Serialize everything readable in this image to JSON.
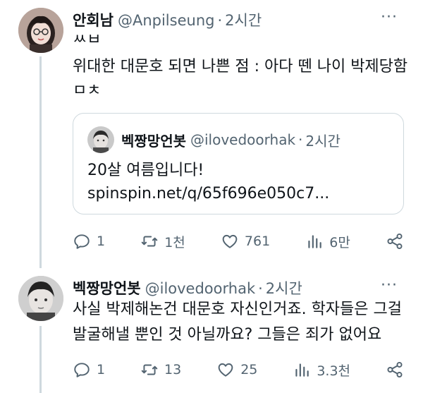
{
  "tweet": {
    "name": "안회남",
    "handle": "@Anpilseung",
    "dot": "·",
    "time": "2시간",
    "more": "···",
    "lines": [
      "ㅆㅂ",
      "위대한 대문호 되면 나쁜 점 : 아다 뗀 나이 박제당함",
      "ㅁㅊ"
    ],
    "quote": {
      "name": "벡짱망언봇",
      "handle": "@ilovedoorhak",
      "dot": "·",
      "time": "2시간",
      "lines": [
        "20살 여름입니다!",
        "spinspin.net/q/65f696e050c7..."
      ]
    },
    "actions": {
      "reply": "1",
      "retweet": "1천",
      "like": "761",
      "views": "6만"
    }
  },
  "reply": {
    "name": "벡짱망언봇",
    "handle": "@ilovedoorhak",
    "dot": "·",
    "time": "2시간",
    "more": "···",
    "lines": [
      "사실 박제해논건 대문호 자신인거죠. 학자들은 그걸",
      "발굴해낼 뿐인 것 아닐까요? 그들은 죄가 없어요"
    ],
    "actions": {
      "reply": "1",
      "retweet": "13",
      "like": "25",
      "views": "3.3천"
    }
  },
  "colors": {
    "text": "#0f1419",
    "muted": "#536471",
    "border": "#cfd9de"
  },
  "icons": [
    "reply-icon",
    "retweet-icon",
    "like-icon",
    "views-icon",
    "share-icon"
  ]
}
